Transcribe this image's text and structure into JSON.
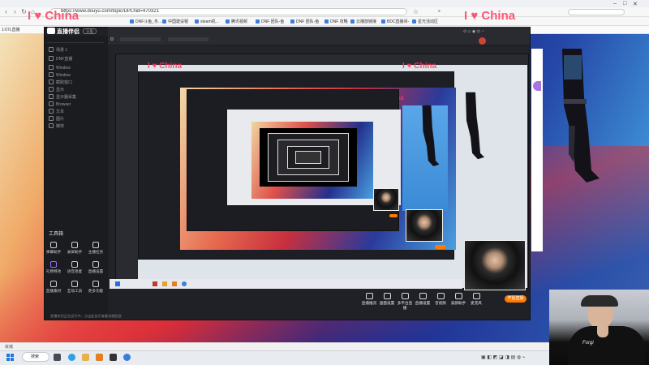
{
  "browser": {
    "url": "https://www.douyu.com/topic/DPLhid=470321",
    "tab_title": "1:07L直播",
    "bookmarks": [
      "DNF斗鱼_冬...",
      "中国建设银",
      "steam机...",
      "腾讯视频",
      "DNF 团队-鱼",
      "DNF 团队-鱼",
      "DNF 攻略",
      "云播放链接",
      "BDC直播间-",
      "星光活动区"
    ]
  },
  "watermark": "I ♥ China",
  "app": {
    "logo": "直播伴侣",
    "badge": "斗鱼",
    "sidebar_items": [
      "场景 1",
      "DNF直播",
      "Window",
      "Window",
      "截取窗口",
      "显示",
      "显示器采集",
      "Browser",
      "文本",
      "图片",
      "媒体"
    ],
    "tools_title": "工具箱",
    "tools": [
      "弹幕助手",
      "录屏助手",
      "主播任务",
      "礼物特效",
      "语音连麦",
      "直播设置",
      "直播素材",
      "互动工具",
      "更多功能"
    ],
    "bottom_buttons": [
      "直播推流",
      "画面设置",
      "多平台直播",
      "直播设置",
      "音视频",
      "美颜助手",
      "麦克风"
    ],
    "go_live": "开始直播",
    "footer_note": "直播伴侣正在运行中，点击此处可查看详细信息"
  },
  "status_text": "就绪",
  "taskbar": {
    "search_placeholder": "搜索"
  },
  "colors": {
    "accent": "#ff7a00",
    "watermark": "#ff3b5c",
    "app_bg": "#202126"
  }
}
